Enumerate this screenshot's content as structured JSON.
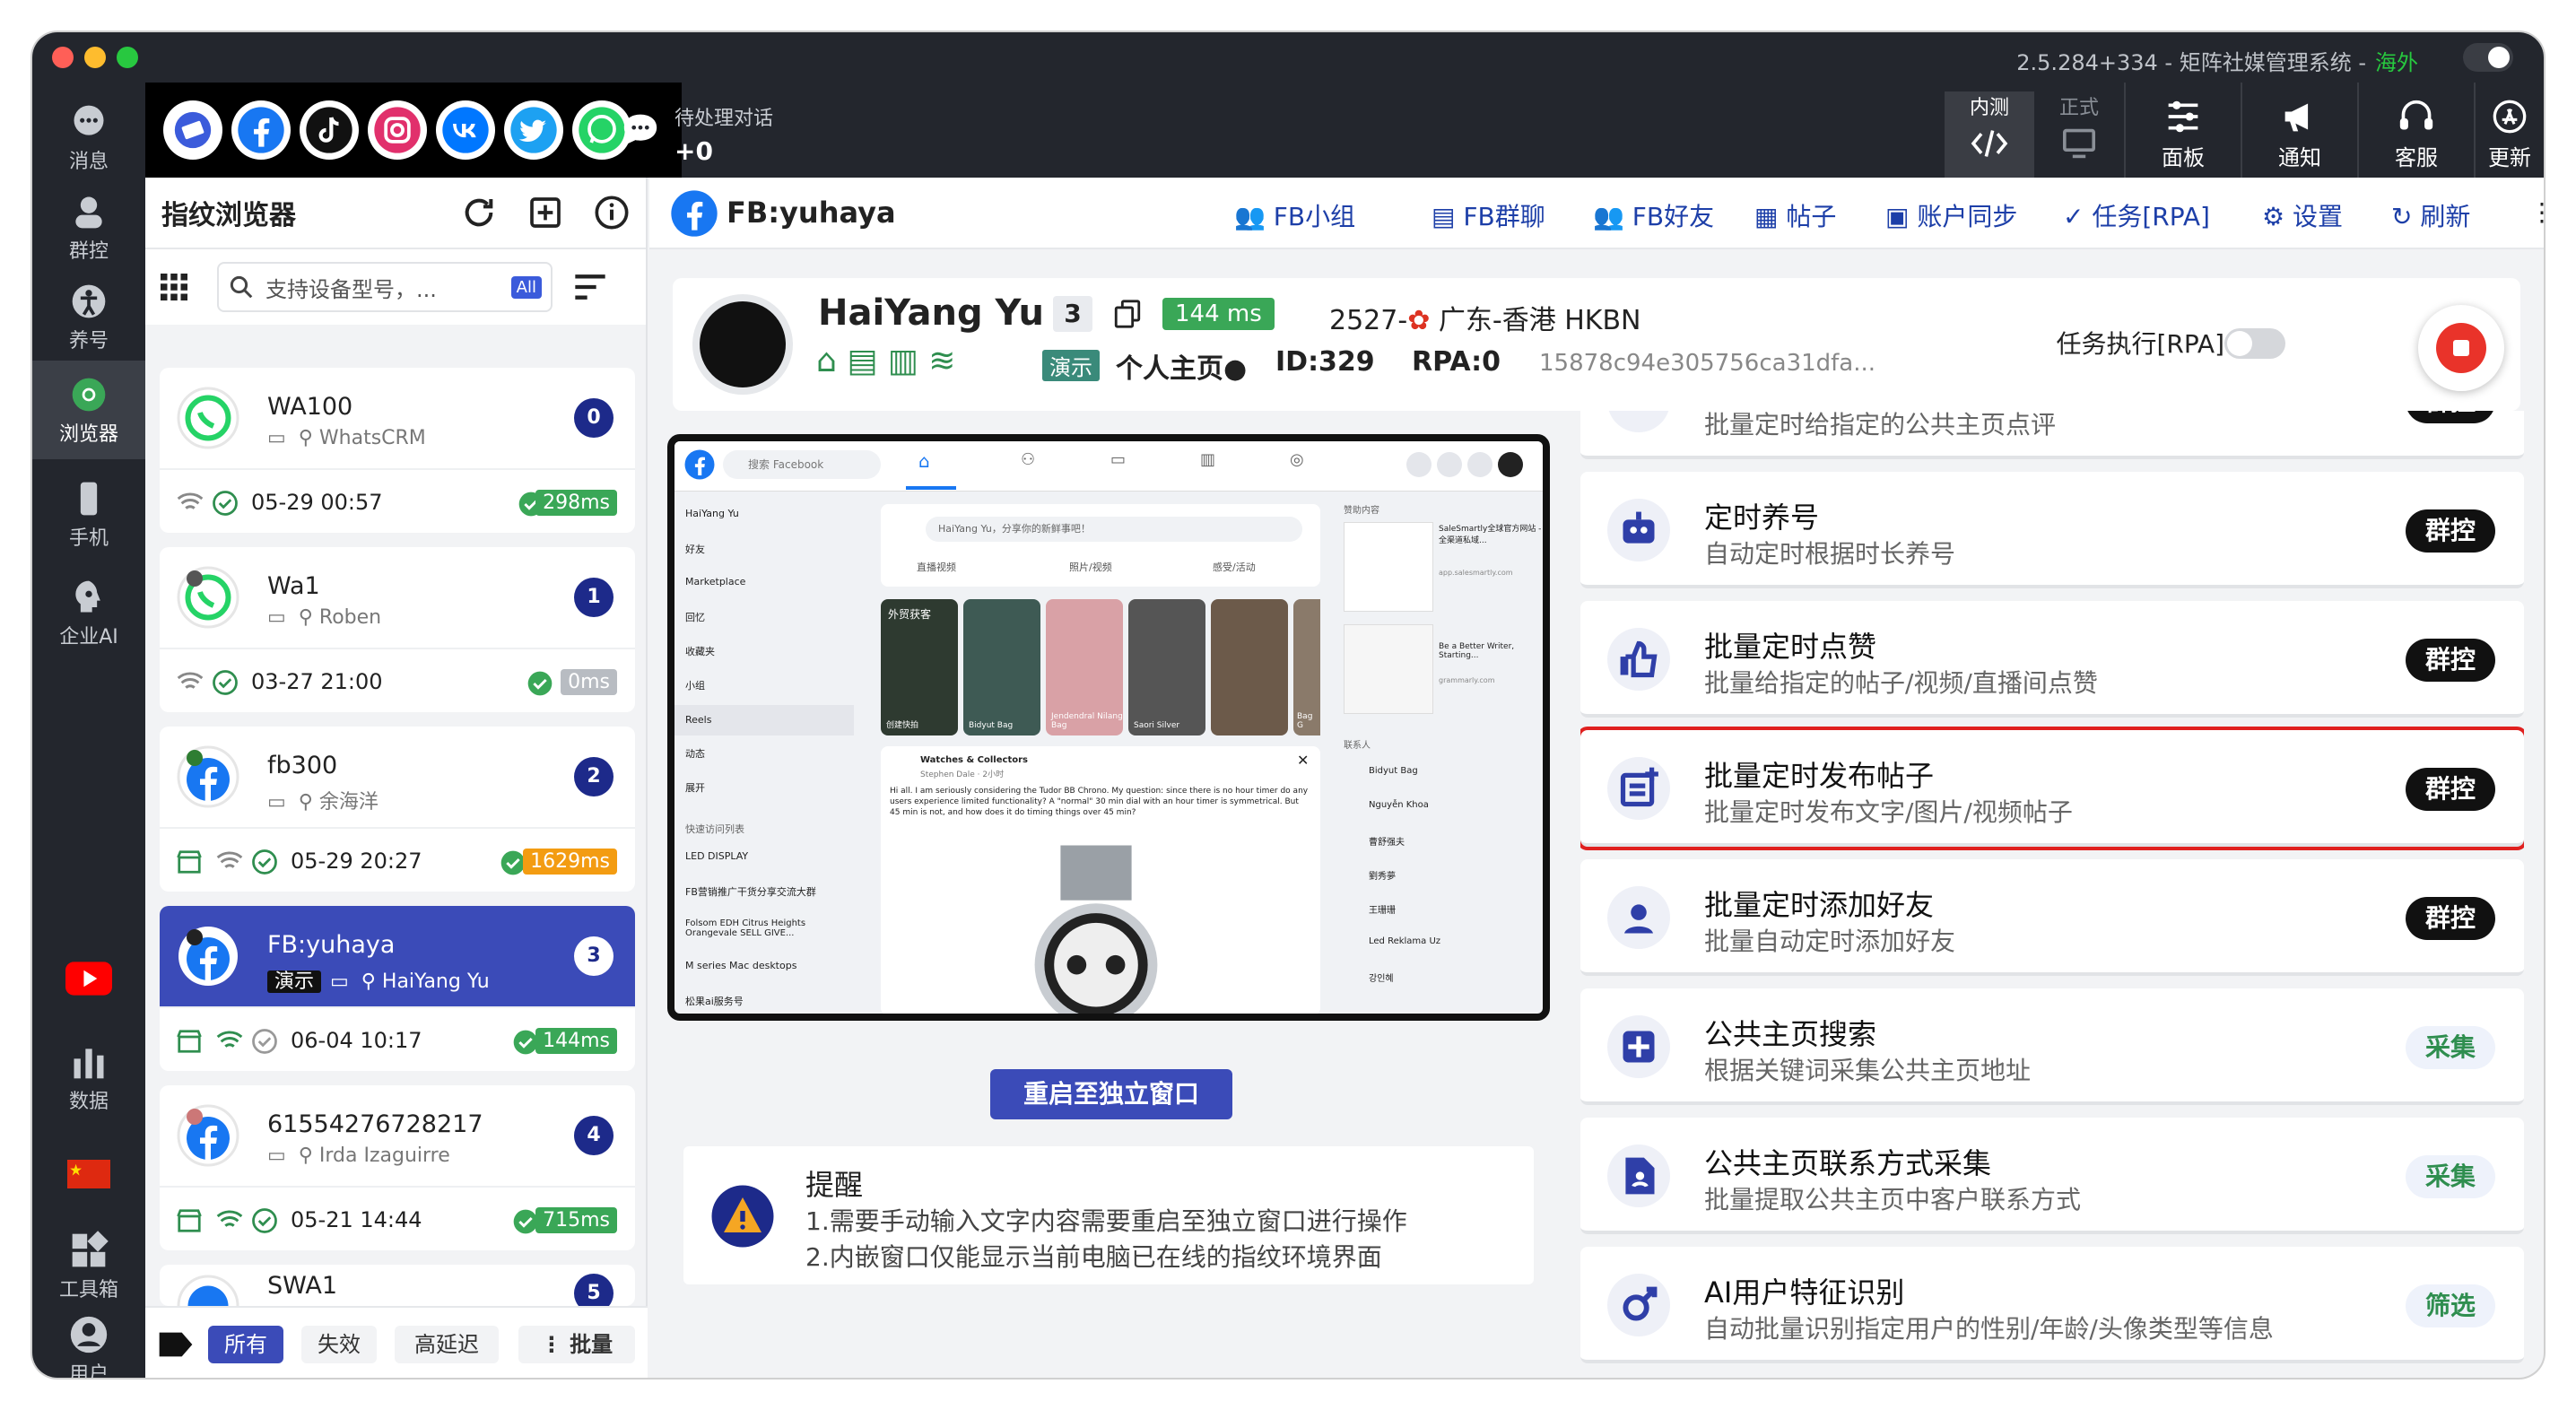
{
  "window": {
    "version_title": "2.5.284+334 - 矩阵社媒管理系统 -",
    "region": "海外"
  },
  "left_nav": [
    {
      "label": "消息",
      "icon": "message-icon"
    },
    {
      "label": "群控",
      "icon": "group-control-icon"
    },
    {
      "label": "养号",
      "icon": "account-nurture-icon"
    },
    {
      "label": "浏览器",
      "icon": "browser-icon"
    },
    {
      "label": "手机",
      "icon": "phone-icon"
    },
    {
      "label": "企业AI",
      "icon": "enterprise-ai-icon"
    },
    {
      "label": "数据",
      "icon": "data-chart-icon"
    },
    {
      "label": "工具箱",
      "icon": "toolbox-icon"
    },
    {
      "label": "用户",
      "icon": "user-icon"
    }
  ],
  "topbar": {
    "pending_label": "待处理对话",
    "pending_value": "+0",
    "env_test": "内测",
    "env_prod": "正式",
    "buttons": [
      "面板",
      "通知",
      "客服",
      "更新"
    ]
  },
  "left_panel": {
    "title": "指纹浏览器",
    "search_placeholder": "支持设备型号，...",
    "search_scope": "All",
    "profiles": [
      {
        "name": "WA100",
        "sub": "WhatsCRM",
        "count": "0",
        "datetime": "05-29 00:57",
        "latency": "298ms",
        "latency_color": "#3aa757",
        "icon": "whatsapp-icon"
      },
      {
        "name": "Wa1",
        "sub": "Roben",
        "count": "1",
        "datetime": "03-27 21:00",
        "latency": "0ms",
        "latency_color": "#b8bcc2",
        "icon": "whatsapp-icon"
      },
      {
        "name": "fb300",
        "sub": "余海洋",
        "count": "2",
        "datetime": "05-29 20:27",
        "latency": "1629ms",
        "latency_color": "#f39c12",
        "icon": "facebook-icon"
      },
      {
        "name": "FB:yuhaya",
        "tag": "演示",
        "sub": "HaiYang Yu",
        "count": "3",
        "datetime": "06-04 10:17",
        "latency": "144ms",
        "latency_color": "#3aa757",
        "icon": "facebook-icon"
      },
      {
        "name": "61554276728217",
        "sub": "Irda Izaguirre",
        "count": "4",
        "datetime": "05-21 14:44",
        "latency": "715ms",
        "latency_color": "#3aa757",
        "icon": "facebook-icon"
      },
      {
        "name": "SWA1",
        "sub": "",
        "count": "5",
        "datetime": "",
        "latency": "",
        "latency_color": "#3aa757",
        "icon": "whatsapp-icon"
      }
    ],
    "filters": [
      "所有",
      "失效",
      "高延迟"
    ],
    "batch_label": "批量"
  },
  "main": {
    "title": "FB:yuhaya",
    "nav": [
      "FB小组",
      "FB群聊",
      "FB好友",
      "帖子",
      "账户同步",
      "任务[RPA]",
      "设置",
      "刷新"
    ],
    "profile": {
      "name": "HaiYang Yu",
      "index": "3",
      "latency": "144 ms",
      "location": "2527-",
      "region": "广东-香港 HKBN",
      "demo_tag": "演示",
      "homepage": "个人主页",
      "id_text": "ID:329",
      "rpa_text": "RPA:0",
      "hash": "15878c94e305756ca31dfa...",
      "rpa_label": "任务执行[RPA]"
    },
    "restart_label": "重启至独立窗口",
    "reminder": {
      "title": "提醒",
      "line1": "1.需要手动输入文字内容需要重启至独立窗口进行操作",
      "line2": "2.内嵌窗口仅能显示当前电脑已在线的指纹环境界面"
    }
  },
  "fb_embed": {
    "search": "搜索 Facebook",
    "user": "HaiYang Yu",
    "compose": "HaiYang Yu，分享你的新鲜事吧！",
    "actions": [
      "直播视频",
      "照片/视频",
      "感受/活动"
    ],
    "left_menu": [
      "HaiYang Yu",
      "好友",
      "Marketplace",
      "回忆",
      "收藏夹",
      "小组",
      "Reels",
      "动态",
      "展开"
    ],
    "shortcuts_title": "快速访问列表",
    "shortcuts": [
      "LED DISPLAY",
      "FB营销推广干货分享交流大群",
      "Folsom EDH Citrus Heights Orangevale SELL GIVE...",
      "M series Mac desktops",
      "松果ai服务号"
    ],
    "stories": [
      "创建快拍",
      "Bidyut Bag",
      "Jendendral Nilang Bag",
      "Saori Silver",
      "",
      "Bag G"
    ],
    "post_author": "Watches & Collectors",
    "post_sub": "Stephen Dale · 2小时",
    "post_text": "Hi all.  I am seriously considering the Tudor BB Chrono.  My question:  since there is no hour timer do any users experience limited functionality?  A \"normal\" 30 min dial with an hour timer is symmetrical.  But 45 min is not, and how does it do timing things over 45 min?",
    "sponsored_title": "赞助内容",
    "ads": [
      {
        "text": "SaleSmartly全球官方网站 - 全渠道私域...",
        "domain": "app.salesmartly.com"
      },
      {
        "text": "Be a Better Writer, Starting...",
        "domain": "grammarly.com"
      }
    ],
    "contacts_title": "联系人",
    "contacts": [
      "Bidyut Bag",
      "Nguyễn Khoa",
      "曹舒强夫",
      "劉秀夢",
      "王珊珊",
      "Led Reklama Uz",
      "강인혜"
    ],
    "story_banner": "外贸获客"
  },
  "tasks": [
    {
      "title": "",
      "desc": "批量定时给指定的公共主页点评",
      "action": "群控",
      "style": "dark",
      "icon": "comment-icon"
    },
    {
      "title": "定时养号",
      "desc": "自动定时根据时长养号",
      "action": "群控",
      "style": "dark",
      "icon": "robot-icon"
    },
    {
      "title": "批量定时点赞",
      "desc": "批量给指定的帖子/视频/直播间点赞",
      "action": "群控",
      "style": "dark",
      "icon": "thumbs-up-icon"
    },
    {
      "title": "批量定时发布帖子",
      "desc": "批量定时发布文字/图片/视频帖子",
      "action": "群控",
      "style": "dark",
      "icon": "post-add-icon",
      "highlight": true
    },
    {
      "title": "批量定时添加好友",
      "desc": "批量自动定时添加好友",
      "action": "群控",
      "style": "dark",
      "icon": "add-friend-icon"
    },
    {
      "title": "公共主页搜索",
      "desc": "根据关键词采集公共主页地址",
      "action": "采集",
      "style": "light",
      "icon": "page-search-icon"
    },
    {
      "title": "公共主页联系方式采集",
      "desc": "批量提取公共主页中客户联系方式",
      "action": "采集",
      "style": "light",
      "icon": "contact-collect-icon"
    },
    {
      "title": "AI用户特征识别",
      "desc": "自动批量识别指定用户的性别/年龄/头像类型等信息",
      "action": "筛选",
      "style": "light",
      "icon": "gender-icon"
    }
  ],
  "colors": {
    "accent": "#3b4bb8",
    "sidebar": "#23262d",
    "success": "#3aa757",
    "danger": "#e0201f"
  }
}
